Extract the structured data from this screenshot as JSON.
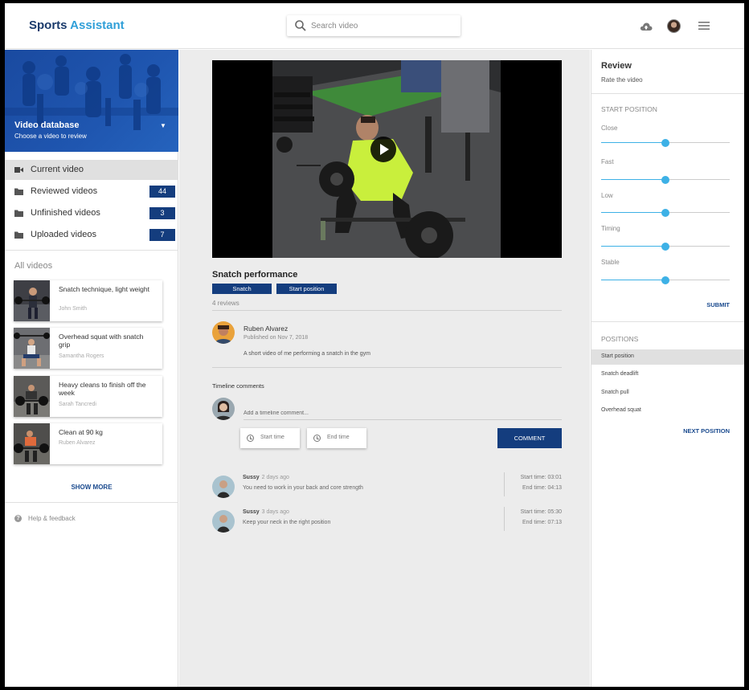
{
  "header": {
    "brand_part1": "Sports",
    "brand_part2": "Assistant",
    "search_placeholder": "Search video",
    "icons": [
      "search-icon",
      "cloud-upload-icon",
      "avatar",
      "menu-icon"
    ]
  },
  "sidebar": {
    "banner_title": "Video database",
    "banner_subtitle": "Choose a video to review",
    "nav": [
      {
        "label": "Current video",
        "icon": "videocam-icon",
        "badge": ""
      },
      {
        "label": "Reviewed videos",
        "icon": "folder-icon",
        "badge": "44"
      },
      {
        "label": "Unfinished videos",
        "icon": "folder-icon",
        "badge": "3"
      },
      {
        "label": "Uploaded videos",
        "icon": "folder-icon",
        "badge": "7"
      }
    ],
    "all_videos_title": "All videos",
    "videos": [
      {
        "title": "Snatch technique, light weight",
        "author": "John Smith"
      },
      {
        "title": "Overhead squat with snatch grip",
        "author": "Samantha Rogers"
      },
      {
        "title": "Heavy cleans to finish off the week",
        "author": "Sarah Tancredi"
      },
      {
        "title": "Clean at 90 kg",
        "author": "Ruben Alvarez"
      }
    ],
    "show_more": "SHOW MORE",
    "help": "Help & feedback"
  },
  "main": {
    "video_title": "Snatch performance",
    "tags": [
      "Snatch",
      "Start position"
    ],
    "reviews": "4 reviews",
    "author": "Ruben Alvarez",
    "published": "Published on Nov 7, 2018",
    "description": "A short video of me performing a snatch in the gym",
    "timeline_title": "Timeline comments",
    "timeline_placeholder": "Add a timeline comment...",
    "start_time_label": "Start time",
    "end_time_label": "End time",
    "comment_button": "COMMENT",
    "comments": [
      {
        "name": "Sussy",
        "when": "2 days ago",
        "text": "You need to work in your back and core strength",
        "start": "Start time: 03:01",
        "end": "End time: 04:13"
      },
      {
        "name": "Sussy",
        "when": "3 days ago",
        "text": "Keep your neck in the right position",
        "start": "Start time: 05:30",
        "end": "End time: 07:13"
      }
    ]
  },
  "review": {
    "title": "Review",
    "subtitle": "Rate the video",
    "section_start": "START POSITION",
    "sliders": [
      {
        "label": "Close",
        "value": 0.5
      },
      {
        "label": "Fast",
        "value": 0.5
      },
      {
        "label": "Low",
        "value": 0.5
      },
      {
        "label": "Timing",
        "value": 0.5
      },
      {
        "label": "Stable",
        "value": 0.5
      }
    ],
    "submit": "SUBMIT",
    "section_positions": "POSITIONS",
    "positions": [
      "Start position",
      "Snatch deadlift",
      "Snatch pull",
      "Overhead squat"
    ],
    "next_position": "NEXT POSITION"
  },
  "colors": {
    "primary": "#143d7e",
    "accent": "#3db1e6",
    "brand_light": "#2f9fd8"
  }
}
